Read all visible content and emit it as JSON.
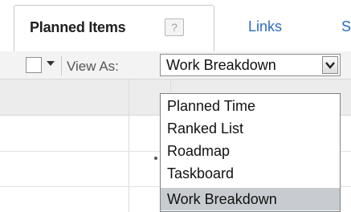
{
  "tabs": [
    {
      "label": "Planned Items",
      "help": "?"
    },
    {
      "label": "Links"
    },
    {
      "label": "S"
    }
  ],
  "toolbar": {
    "view_as_label": "View As:",
    "selected_view": "Work Breakdown"
  },
  "dropdown": {
    "options": [
      "Planned Time",
      "Ranked List",
      "Roadmap",
      "Taskboard",
      "Work Breakdown"
    ],
    "selected_index": 4
  },
  "colors": {
    "link": "#2a6ebd",
    "selected_option_bg": "#c8ccd0"
  }
}
